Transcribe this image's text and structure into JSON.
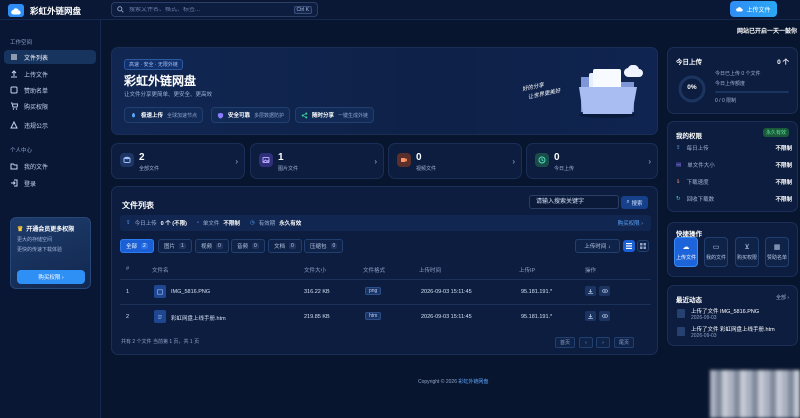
{
  "app": {
    "title": "彩虹外链网盘"
  },
  "search": {
    "placeholder": "搜索文件名、格式、标签...",
    "shortcut": "Ctrl K"
  },
  "header": {
    "upload_label": "上传文件",
    "marquee": "网站已开启一天一鼓你"
  },
  "sidebar": {
    "section_work": "工作空间",
    "section_personal": "个人中心",
    "items": [
      {
        "label": "文件列表",
        "icon": "list-icon"
      },
      {
        "label": "上传文件",
        "icon": "upload-icon"
      },
      {
        "label": "赞助名单",
        "icon": "sponsor-icon"
      },
      {
        "label": "购买权限",
        "icon": "cart-icon"
      },
      {
        "label": "违规公示",
        "icon": "warning-icon"
      }
    ],
    "personal_items": [
      {
        "label": "我的文件",
        "icon": "folder-icon"
      },
      {
        "label": "登录",
        "icon": "login-icon"
      }
    ],
    "promo": {
      "title": "开通会员更多权限",
      "line1": "更大的存储空间",
      "line2": "更快的传速下载体验",
      "button": "购买权限 ›"
    }
  },
  "hero": {
    "tag": "高速 · 安全 · 无限外链",
    "title": "彩虹外链网盘",
    "subtitle": "让文件分享更简单、更安全、更高效",
    "features": [
      {
        "title": "极速上传",
        "desc": "全球加速节点",
        "icon": "rocket-icon"
      },
      {
        "title": "安全可靠",
        "desc": "多层数据防护",
        "icon": "shield-icon"
      },
      {
        "title": "随时分享",
        "desc": "一键生成外链",
        "icon": "share-icon"
      }
    ],
    "slogan_line1": "好的分享",
    "slogan_line2": "让世界更美好"
  },
  "stats": [
    {
      "value": "2",
      "label": "全部文件",
      "color": "#2a4a7e"
    },
    {
      "value": "1",
      "label": "图片文件",
      "color": "#3a3f8c"
    },
    {
      "value": "0",
      "label": "视频文件",
      "color": "#6e3a32"
    },
    {
      "value": "0",
      "label": "今日上传",
      "color": "#1f5a52"
    }
  ],
  "files": {
    "title": "文件列表",
    "keyword_placeholder": "请输入搜索关键字",
    "search_btn": "搜索",
    "quota": {
      "today_label": "今日上传",
      "today_value": "0 个 (不限)",
      "size_label": "单文件",
      "size_value": "不限制",
      "keep_label": "有效期",
      "keep_value": "永久有效",
      "buy": "购买权限 ›"
    },
    "filters": [
      {
        "label": "全部",
        "count": "2"
      },
      {
        "label": "图片",
        "count": "1"
      },
      {
        "label": "视频",
        "count": "0"
      },
      {
        "label": "音频",
        "count": "0"
      },
      {
        "label": "文档",
        "count": "0"
      },
      {
        "label": "压缩包",
        "count": "0"
      }
    ],
    "sort": "上传时间 ↓",
    "columns": [
      "#",
      "文件名",
      "文件大小",
      "文件格式",
      "上传时间",
      "上传IP",
      "操作"
    ],
    "rows": [
      {
        "no": "1",
        "name": "IMG_5816.PNG",
        "size": "316.22 KB",
        "format": "png",
        "time": "2026-09-03 15:11:45",
        "ip": "95.181.191.*"
      },
      {
        "no": "2",
        "name": "彩虹网盘上线手册.htm",
        "size": "219.85 KB",
        "format": "htm",
        "time": "2026-09-03 15:11:45",
        "ip": "95.181.191.*"
      }
    ],
    "footer": "共有 2 个文件 当前第 1 页，共 1 页",
    "pager": [
      "首页",
      "‹",
      "›",
      "尾页"
    ]
  },
  "copyright": {
    "prefix": "Copyright © 2026",
    "site": "彩虹外链网盘"
  },
  "today": {
    "title": "今日上传",
    "count": "0 个",
    "percent": "0%",
    "line1": "今日已上传 0 个文件",
    "line2": "今日上传额度",
    "line3": "0 / 0 限制"
  },
  "perms": {
    "title": "我的权限",
    "badge": "永久有效",
    "rows": [
      {
        "label": "每日上传",
        "value": "不限制",
        "icon": "upload-icon"
      },
      {
        "label": "单文件大小",
        "value": "不限制",
        "icon": "file-icon"
      },
      {
        "label": "下载速度",
        "value": "不限制",
        "icon": "download-icon"
      },
      {
        "label": "回收下载数",
        "value": "不限制",
        "icon": "recycle-icon"
      }
    ]
  },
  "quick": {
    "title": "快捷操作",
    "items": [
      {
        "label": "上传文件",
        "icon": "upload-cloud-icon"
      },
      {
        "label": "我的文件",
        "icon": "folder-icon"
      },
      {
        "label": "购买权限",
        "icon": "cart-icon"
      },
      {
        "label": "赞助名单",
        "icon": "sponsor-icon"
      }
    ]
  },
  "activity": {
    "title": "最近动态",
    "more": "全部 ›",
    "items": [
      {
        "text": "上传了文件 IMG_5816.PNG",
        "date": "2026-09-03"
      },
      {
        "text": "上传了文件 彩虹网盘上线手册.htm",
        "date": "2026-09-03"
      }
    ]
  }
}
